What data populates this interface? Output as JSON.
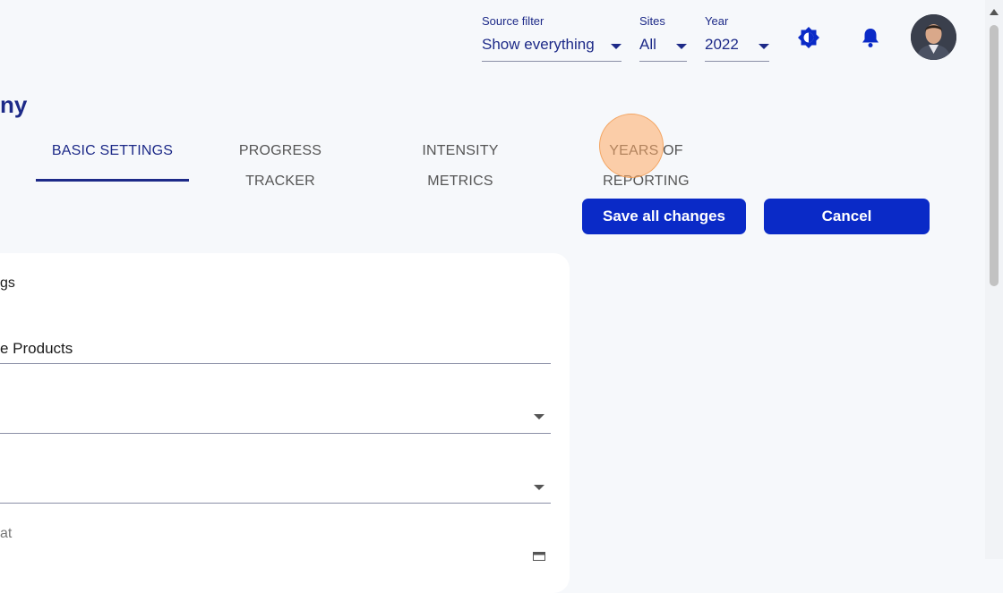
{
  "header": {
    "filters": [
      {
        "label": "Source filter",
        "value": "Show everything"
      },
      {
        "label": "Sites",
        "value": "All"
      },
      {
        "label": "Year",
        "value": "2022"
      }
    ],
    "icons": [
      "brightness-icon",
      "bell-icon"
    ]
  },
  "page": {
    "title": "ny"
  },
  "tabs": [
    {
      "label": "BASIC SETTINGS",
      "active": true
    },
    {
      "label": "PROGRESS TRACKER",
      "active": false
    },
    {
      "label": "INTENSITY METRICS",
      "active": false
    },
    {
      "label": "YEARS OF REPORTING",
      "active": false
    }
  ],
  "actions": {
    "save_label": "Save all changes",
    "cancel_label": "Cancel"
  },
  "form": {
    "section_title": "gs",
    "company_value": "e Products",
    "date_label": "at"
  },
  "colors": {
    "accent": "#0a2ac7",
    "brand_text": "#1d2a88",
    "card": "#ffffff",
    "background": "#f6f8fb"
  }
}
